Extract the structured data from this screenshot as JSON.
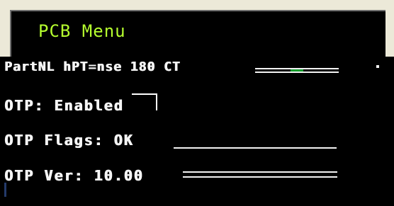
{
  "title": "PCB Menu",
  "rows": [
    {
      "text": "PartNL hPT=nse 180 CT"
    },
    {
      "text": "OTP: Enabled"
    },
    {
      "text": "OTP Flags: OK"
    },
    {
      "text": "OTP Ver: 10.00"
    }
  ],
  "colors": {
    "title": "#b6ff2f",
    "background": "#000000",
    "frame": "#ece9d8",
    "text": "#f4f4f4"
  }
}
